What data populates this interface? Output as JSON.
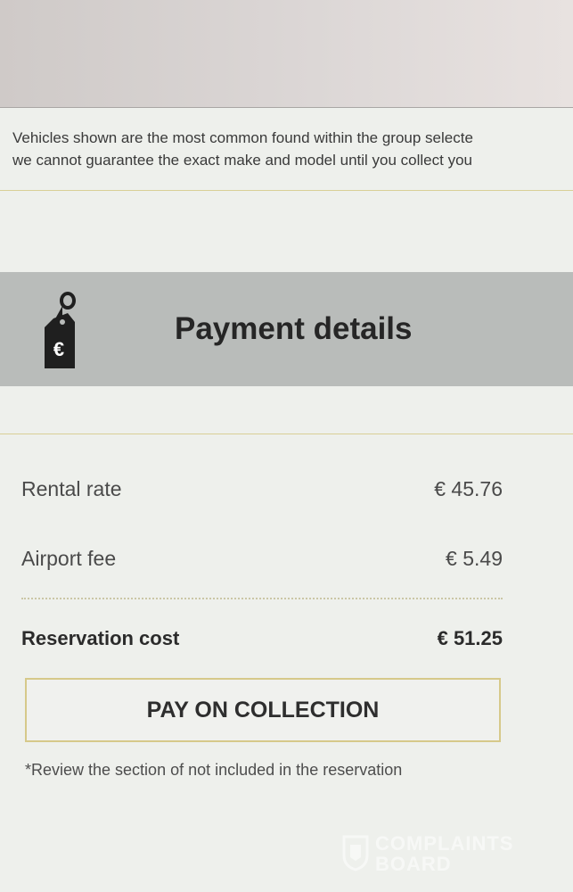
{
  "notice": {
    "line1": "Vehicles shown are the most common found within the group selecte",
    "line2": "we cannot guarantee the exact make and model until you collect you"
  },
  "payment": {
    "title": "Payment details",
    "icon": "euro-price-tag-icon",
    "rows": [
      {
        "label": "Rental rate",
        "value": "€ 45.76"
      },
      {
        "label": "Airport fee",
        "value": "€ 5.49"
      }
    ],
    "total": {
      "label": "Reservation cost",
      "value": "€ 51.25"
    },
    "button_label": "PAY ON COLLECTION",
    "footnote": "*Review the section of not included in the reservation"
  },
  "watermark": {
    "line1": "COMPLAINTS",
    "line2": "BOARD"
  },
  "colors": {
    "header_band": "#b9bcba",
    "accent_gold": "#d6c98a",
    "background": "#eef0ec"
  }
}
